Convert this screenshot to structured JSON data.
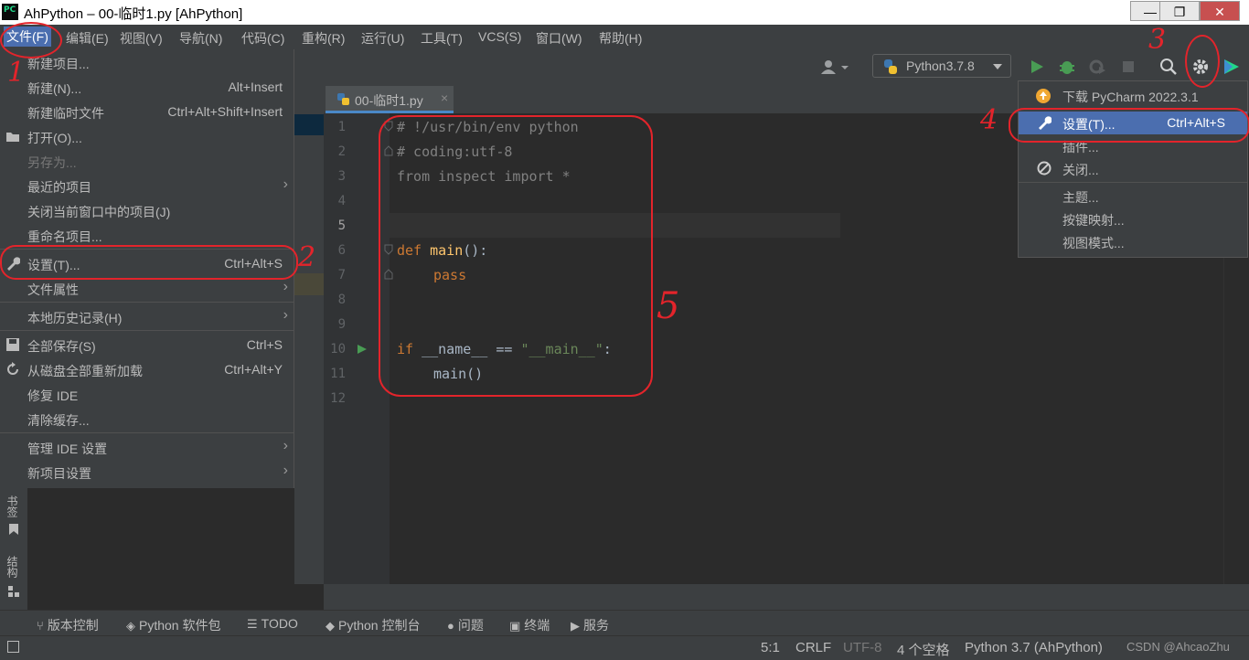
{
  "window": {
    "title": "AhPython – 00-临时1.py [AhPython]",
    "min": "—",
    "max": "❐",
    "close": "✕"
  },
  "menubar": [
    "文件(F)",
    "编辑(E)",
    "视图(V)",
    "导航(N)",
    "代码(C)",
    "重构(R)",
    "运行(U)",
    "工具(T)",
    "VCS(S)",
    "窗口(W)",
    "帮助(H)"
  ],
  "toolbar": {
    "run_config": "Python3.7.8"
  },
  "editor_tab": {
    "label": "00-临时1.py",
    "close": "×"
  },
  "file_menu": [
    {
      "label": "新建项目...",
      "shortcut": "",
      "submenu": false,
      "disabled": false,
      "icon": ""
    },
    {
      "label": "新建(N)...",
      "shortcut": "Alt+Insert",
      "submenu": false,
      "disabled": false,
      "icon": ""
    },
    {
      "label": "新建临时文件",
      "shortcut": "Ctrl+Alt+Shift+Insert",
      "submenu": false,
      "disabled": false,
      "icon": ""
    },
    {
      "label": "打开(O)...",
      "shortcut": "",
      "submenu": false,
      "disabled": false,
      "icon": "folder-icon"
    },
    {
      "label": "另存为...",
      "shortcut": "",
      "submenu": false,
      "disabled": true,
      "icon": ""
    },
    {
      "label": "最近的项目",
      "shortcut": "",
      "submenu": true,
      "disabled": false,
      "icon": ""
    },
    {
      "label": "关闭当前窗口中的项目(J)",
      "shortcut": "",
      "submenu": false,
      "disabled": false,
      "icon": ""
    },
    {
      "label": "重命名项目...",
      "shortcut": "",
      "submenu": false,
      "disabled": false,
      "icon": ""
    },
    {
      "label": "设置(T)...",
      "shortcut": "Ctrl+Alt+S",
      "submenu": false,
      "disabled": false,
      "icon": "wrench-icon"
    },
    {
      "label": "文件属性",
      "shortcut": "",
      "submenu": true,
      "disabled": false,
      "icon": ""
    },
    {
      "label": "本地历史记录(H)",
      "shortcut": "",
      "submenu": true,
      "disabled": false,
      "icon": ""
    },
    {
      "label": "全部保存(S)",
      "shortcut": "Ctrl+S",
      "submenu": false,
      "disabled": false,
      "icon": "save-icon"
    },
    {
      "label": "从磁盘全部重新加载",
      "shortcut": "Ctrl+Alt+Y",
      "submenu": false,
      "disabled": false,
      "icon": "reload-icon"
    },
    {
      "label": "修复 IDE",
      "shortcut": "",
      "submenu": false,
      "disabled": false,
      "icon": ""
    },
    {
      "label": "清除缓存...",
      "shortcut": "",
      "submenu": false,
      "disabled": false,
      "icon": ""
    },
    {
      "label": "管理 IDE 设置",
      "shortcut": "",
      "submenu": true,
      "disabled": false,
      "icon": ""
    },
    {
      "label": "新项目设置",
      "shortcut": "",
      "submenu": true,
      "disabled": false,
      "icon": ""
    }
  ],
  "gear_menu": [
    {
      "label": "下载 PyCharm 2022.3.1",
      "shortcut": "",
      "icon": "update-icon"
    },
    {
      "label": "设置(T)...",
      "shortcut": "Ctrl+Alt+S",
      "icon": "wrench-icon"
    },
    {
      "label": "插件...",
      "shortcut": "",
      "icon": ""
    },
    {
      "label": "关闭...",
      "shortcut": "",
      "icon": "block-icon"
    },
    {
      "label": "主题...",
      "shortcut": "",
      "icon": ""
    },
    {
      "label": "按键映射...",
      "shortcut": "",
      "icon": ""
    },
    {
      "label": "视图模式...",
      "shortcut": "",
      "icon": ""
    }
  ],
  "code": {
    "line_numbers": [
      "1",
      "2",
      "3",
      "4",
      "5",
      "6",
      "7",
      "8",
      "9",
      "10",
      "11",
      "12"
    ],
    "l1": "# !/usr/bin/env python",
    "l2": "# coding:utf-8",
    "l3": "from inspect import *",
    "l6_kw": "def",
    "l6_fn": "main",
    "l6_rest": "():",
    "l7": "pass",
    "l10_kw": "if",
    "l10_mid": " __name__ == ",
    "l10_str": "\"__main__\"",
    "l10_end": ":",
    "l11": "main()"
  },
  "left_strip": {
    "bookmarks": "书签",
    "structure": "结构"
  },
  "tool_windows": [
    "版本控制",
    "Python 软件包",
    "TODO",
    "Python 控制台",
    "问题",
    "终端",
    "服务"
  ],
  "status": {
    "pos": "5:1",
    "line_sep": "CRLF",
    "encoding": "UTF-8",
    "indent": "4 个空格",
    "interpreter": "Python 3.7 (AhPython)",
    "watermark": "CSDN @AhcaoZhu"
  },
  "annotations": [
    "1",
    "2",
    "3",
    "4",
    "5"
  ]
}
